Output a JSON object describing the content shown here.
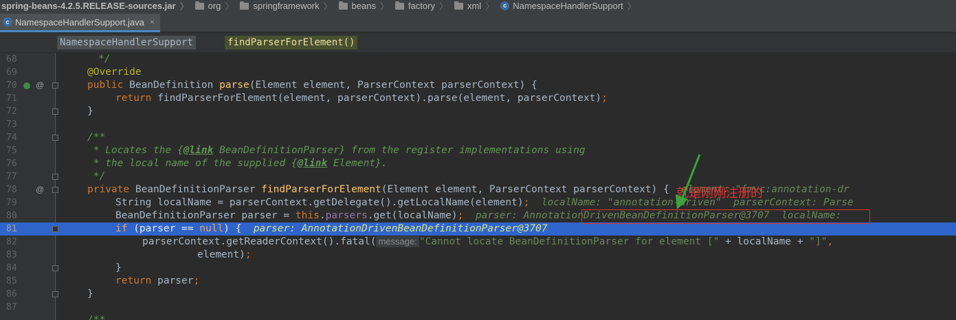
{
  "breadcrumb": {
    "jar": "spring-beans-4.2.5.RELEASE-sources.jar",
    "items": [
      "org",
      "springframework",
      "beans",
      "factory",
      "xml",
      "NamespaceHandlerSupport"
    ]
  },
  "tab": {
    "label": "NamespaceHandlerSupport.java",
    "close": "×"
  },
  "structure": {
    "class_name": "NamespaceHandlerSupport",
    "method_name": "findParserForElement()"
  },
  "lines": {
    "n68": "68",
    "n69": "69",
    "n70": "70",
    "n71": "71",
    "n72": "72",
    "n73": "73",
    "n74": "74",
    "n75": "75",
    "n76": "76",
    "n77": "77",
    "n78": "78",
    "n79": "79",
    "n80": "80",
    "n81": "81",
    "n82": "82",
    "n83": "83",
    "n84": "84",
    "n85": "85",
    "n86": "86",
    "n87": "87"
  },
  "code": {
    "l68": "*/",
    "l69": "@Override",
    "l70a": "public",
    "l70b": " BeanDefinition ",
    "l70c": "parse",
    "l70d": "(Element element, ParserContext parserContext) {",
    "l71a": "return",
    "l71b": " findParserForElement(element, parserContext).parse(element, parserContext)",
    "l71c": ";",
    "l72": "}",
    "l74": "/**",
    "l75a": " * Locates the {",
    "l75b": "@link",
    "l75c": " BeanDefinitionParser} from the register implementations using",
    "l76a": " * the local name of the supplied {",
    "l76b": "@link",
    "l76c": " Element}.",
    "l77": " */",
    "l78a": "private",
    "l78b": " BeanDefinitionParser ",
    "l78c": "findParserForElement",
    "l78d": "(Element element, ParserContext parserContext) {",
    "l78hint": "element: \"[mvc:annotation-dr",
    "l79a": "String localName = parserContext.getDelegate().getLocalName(element)",
    "l79b": ";",
    "l79hint": "localName: \"annotation-driven\"  parserContext: Parse",
    "l80a": "BeanDefinitionParser parser = ",
    "l80b": "this",
    "l80c": ".",
    "l80d": "parsers",
    "l80e": ".get(localName)",
    "l80f": ";",
    "l80hint1": "parser: ",
    "l80hint2": "AnnotationDrivenBeanDefinitionParser@3707",
    "l80hint3": "localName:",
    "l81a": "if",
    "l81b": " (parser == ",
    "l81c": "null",
    "l81d": ") {",
    "l81hint": "parser: AnnotationDrivenBeanDefinitionParser@3707",
    "l82a": "parserContext.getReaderContext().fatal(",
    "l82hint": "message:",
    "l82b": "\"Cannot locate BeanDefinitionParser for element [\"",
    "l82c": " + localName + ",
    "l82d": "\"]\"",
    "l82e": ",",
    "l83a": "element)",
    "l83b": ";",
    "l84": "}",
    "l85a": "return",
    "l85b": " parser",
    "l85c": ";",
    "l86": "}",
    "l88": "/**"
  },
  "annotation_note": "就是刚刚注册的",
  "colors": {
    "keyword": "#cc7832",
    "comment": "#629755",
    "string": "#6a8759",
    "field": "#9876aa",
    "annotation": "#bbb529",
    "function": "#ffc66d",
    "current_line": "#2f65ca",
    "highlight_box": "#e0322b",
    "arrow": "#3aa53a"
  }
}
